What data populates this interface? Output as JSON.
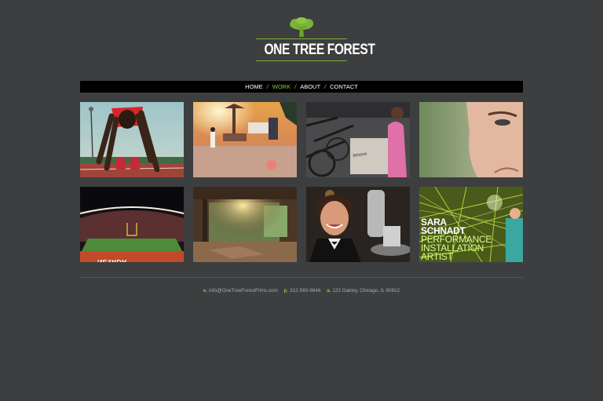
{
  "brand": {
    "name": "ONE TREE FOREST",
    "accent": "#8cc63f"
  },
  "nav": {
    "items": [
      {
        "label": "HOME",
        "active": false
      },
      {
        "label": "WORK",
        "active": true
      },
      {
        "label": "ABOUT",
        "active": false
      },
      {
        "label": "CONTACT",
        "active": false
      }
    ],
    "separator": "/"
  },
  "gallery": {
    "thumbnails": [
      {
        "subject": "sprinter-in-starting-blocks"
      },
      {
        "subject": "sunset-plaza-child"
      },
      {
        "subject": "bicycles-lenovo-box"
      },
      {
        "subject": "face-closeup"
      },
      {
        "subject": "stadium-night"
      },
      {
        "subject": "rustic-room-sunlight"
      },
      {
        "subject": "waitress-tray"
      },
      {
        "subject": "green-lasers-installation",
        "overlay_text": [
          "SARA",
          "SCHNADT",
          "PERFORMANCE",
          "INSTALLATION",
          "ARTIST"
        ]
      }
    ]
  },
  "footer": {
    "email_key": "e.",
    "email": "info@OneTreeForestFilms.com",
    "phone_key": "p.",
    "phone": "312-560-9646",
    "address_key": "a.",
    "address": "123 Oakley, Chicago, IL 60612"
  }
}
